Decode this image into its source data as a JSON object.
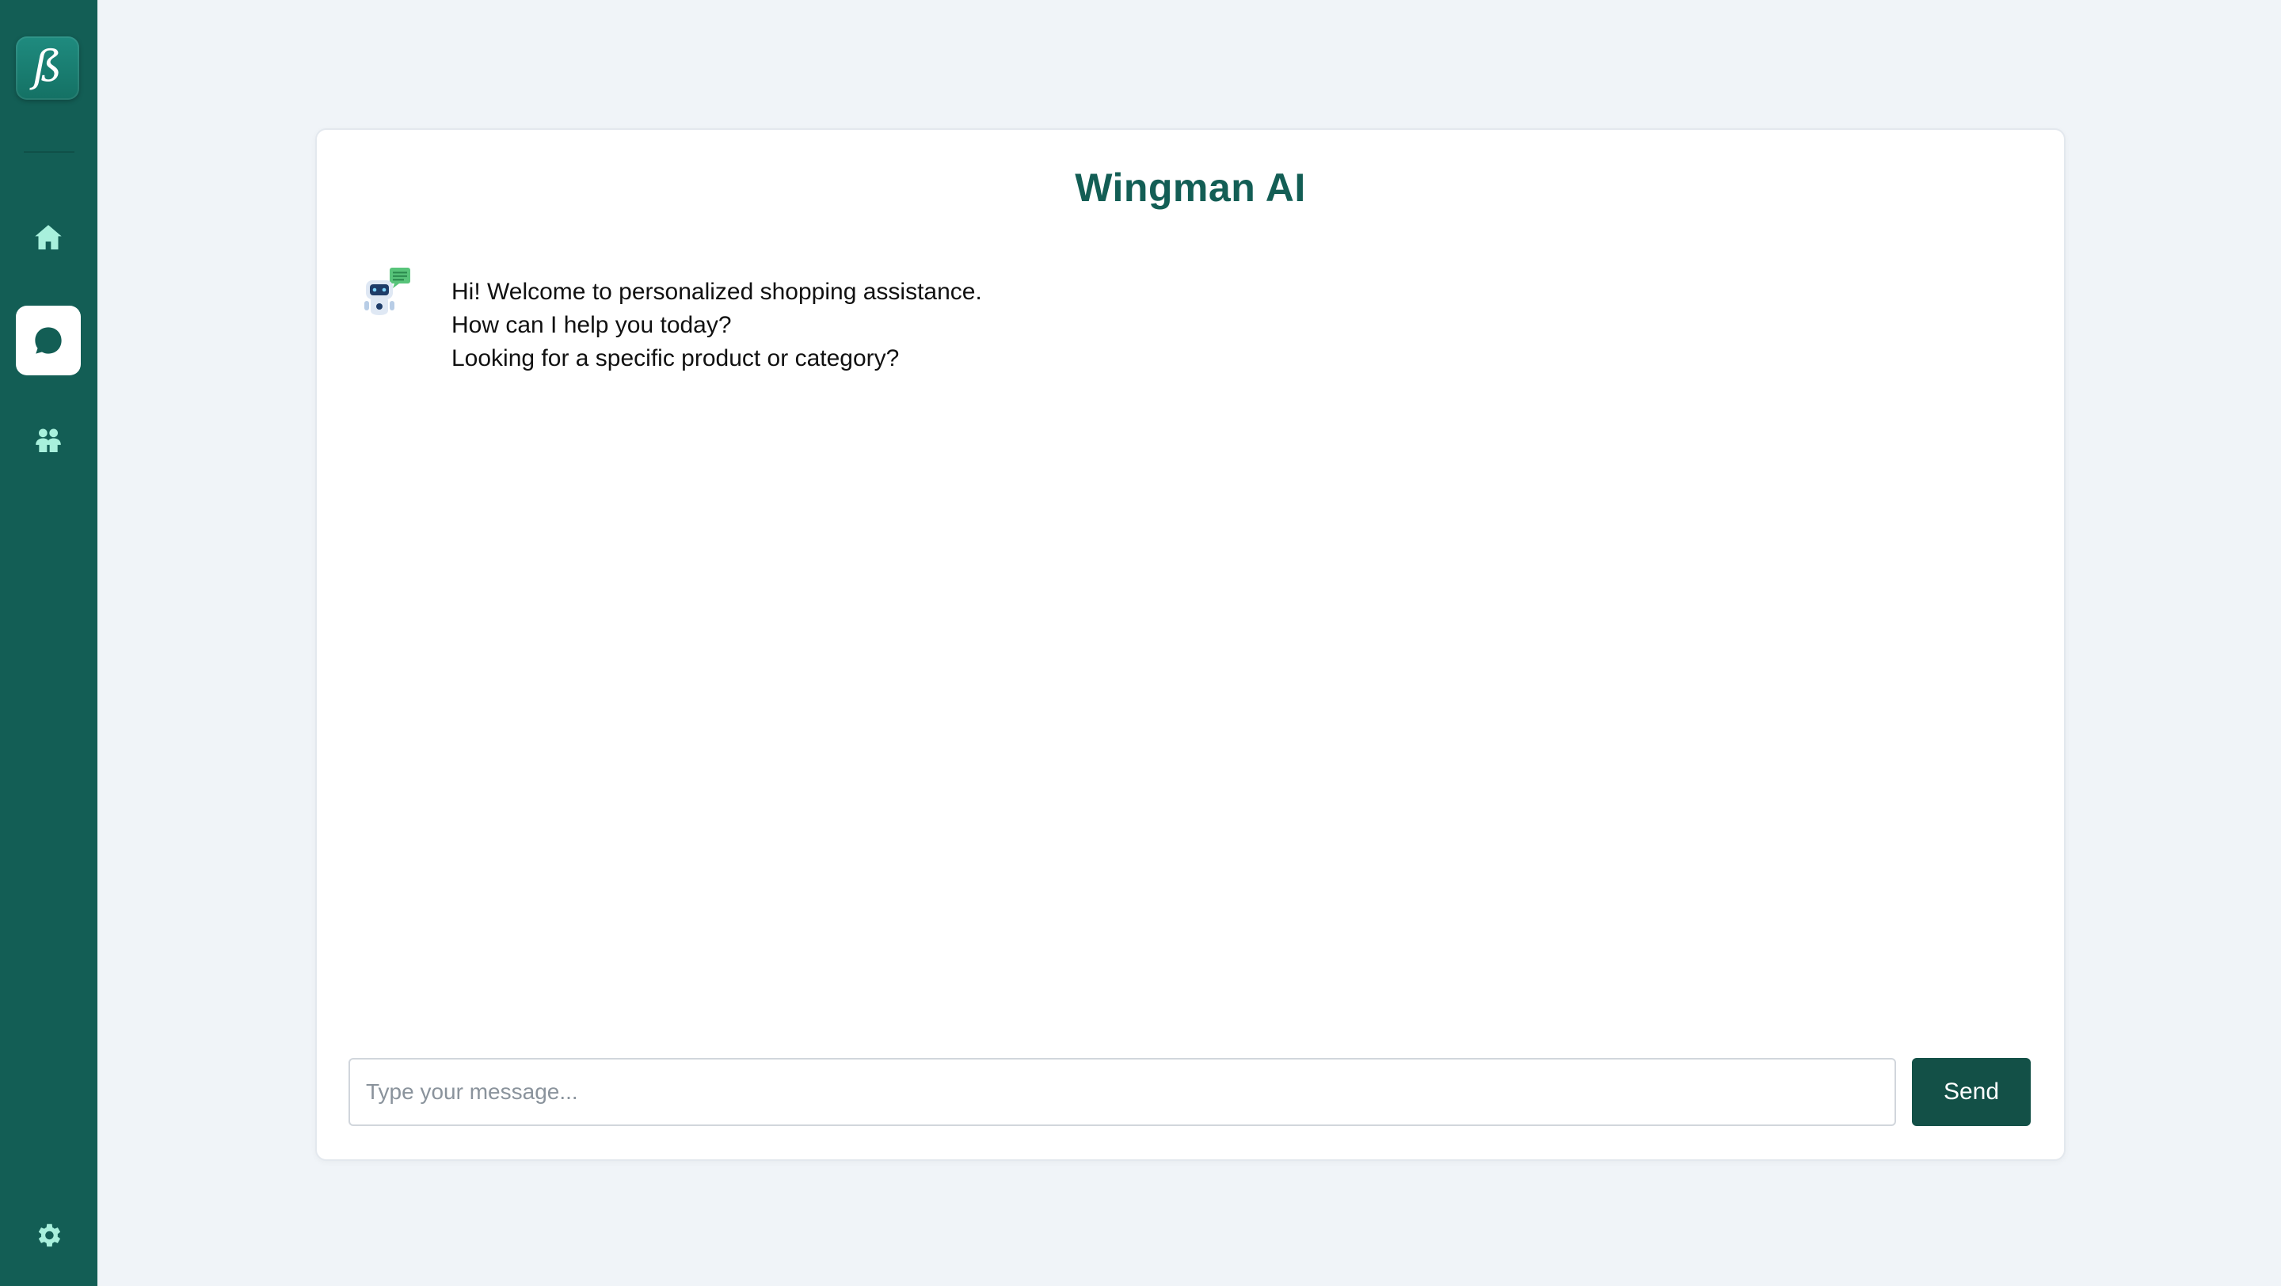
{
  "sidebar": {
    "logo_letter": "ß",
    "items": [
      {
        "name": "home",
        "icon": "home-icon"
      },
      {
        "name": "chat",
        "icon": "chat-icon",
        "active": true
      },
      {
        "name": "users",
        "icon": "users-icon"
      }
    ],
    "settings_icon": "gear-icon",
    "colors": {
      "background": "#135e55",
      "active_bg": "#ffffff",
      "icon": "#a8f0dc"
    }
  },
  "chat": {
    "title": "Wingman AI",
    "messages": [
      {
        "sender": "bot",
        "avatar_icon": "robot-avatar-icon",
        "lines": [
          "Hi! Welcome to personalized shopping assistance.",
          "How can I help you today?",
          "Looking for a specific product or category?"
        ]
      }
    ],
    "input": {
      "placeholder": "Type your message...",
      "value": ""
    },
    "send_label": "Send",
    "colors": {
      "title": "#135e55",
      "send_button": "#135047"
    }
  }
}
